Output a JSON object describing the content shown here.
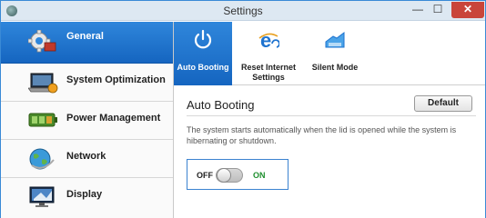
{
  "window": {
    "title": "Settings",
    "min_glyph": "—",
    "max_glyph": "☐",
    "close_glyph": "✕"
  },
  "sidebar": {
    "items": [
      {
        "label": "General",
        "icon": "gear-icon",
        "active": true
      },
      {
        "label": "System Optimization",
        "icon": "laptop-icon",
        "active": false
      },
      {
        "label": "Power Management",
        "icon": "battery-icon",
        "active": false
      },
      {
        "label": "Network",
        "icon": "globe-icon",
        "active": false
      },
      {
        "label": "Display",
        "icon": "monitor-icon",
        "active": false
      }
    ]
  },
  "tabs": [
    {
      "label": "Auto Booting",
      "icon": "power-icon",
      "active": true
    },
    {
      "label": "Reset Internet Settings",
      "icon": "internet-explorer-icon",
      "active": false
    },
    {
      "label": "Silent Mode",
      "icon": "silent-mode-icon",
      "active": false
    }
  ],
  "content": {
    "title": "Auto Booting",
    "default_label": "Default",
    "description": "The system starts automatically when the lid is opened while the system is hibernating or shutdown.",
    "toggle": {
      "off_label": "OFF",
      "on_label": "ON",
      "state": "off"
    }
  },
  "colors": {
    "accent": "#1e73cf",
    "on_text": "#1e8f2e",
    "close": "#c9453a"
  }
}
